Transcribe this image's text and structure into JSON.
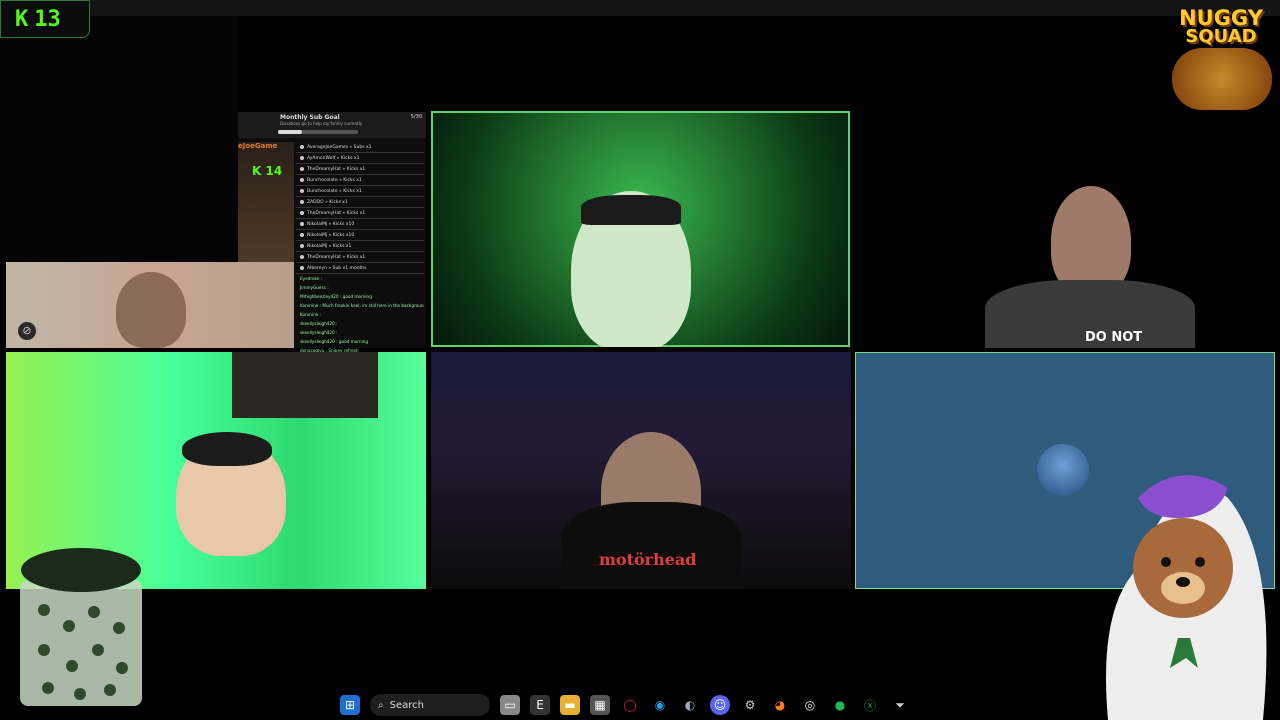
{
  "kick_badge": {
    "logo": "K",
    "count": "13"
  },
  "chat_overlay": {
    "goal_title": "Monthly Sub Goal",
    "goal_subtitle": "Donations go to help my family currently",
    "goal_progress": "5/30",
    "goal_progress_fraction": 0.3,
    "streamer_name": "eJoeGame",
    "kick_logo": "K",
    "kick_count": "14",
    "events": [
      "AverageJoeGames » Subs x1",
      "AyAmonWolf » Kicks x1",
      "TheDreamyHat » Kicks x1",
      "Bunchocolate » Kicks x1",
      "Bunchocolate » Kicks x1",
      "ZADDO » Kicks x1",
      "TheDreamyHat » Kicks x1",
      "NikolaiMj » Kicks x10",
      "NikolaiMj » Kicks x10",
      "NikolaiMj » Kicks x1",
      "TheDreamyHat » Kicks x1",
      "Albereyn » Sub x1 months"
    ],
    "messages": [
      "Eyedroke :",
      "JimmyGuess :",
      "Mrhighbeezley420 : good morning",
      "Korvnine : Much freakin keel, im still here in the background",
      "Korvnine :",
      "skeellysleigh420 :",
      "skeellysleigh420 :",
      "skeellysleigh420 : good morning",
      "donacoglyu : Snipey refresh"
    ]
  },
  "logo": {
    "line1": "NUGGY",
    "line2": "SQUAD"
  },
  "shirt_text": "DO NOT",
  "shirt_text_2": "motörhead",
  "taskbar": {
    "search_label": "Search",
    "icons": [
      "windows-start-icon",
      "search-icon",
      "file-explorer-icon",
      "epic-games-icon",
      "folder-icon",
      "app-icon",
      "opera-icon",
      "edge-icon",
      "steam-icon",
      "discord-icon",
      "settings-icon",
      "firefox-icon",
      "obs-icon",
      "spotify-icon",
      "xbox-icon",
      "filter-icon"
    ]
  },
  "colors": {
    "kick_green": "#53fc18",
    "active_border": "#5fd36a",
    "participant_bg": "#2f5b7c"
  }
}
